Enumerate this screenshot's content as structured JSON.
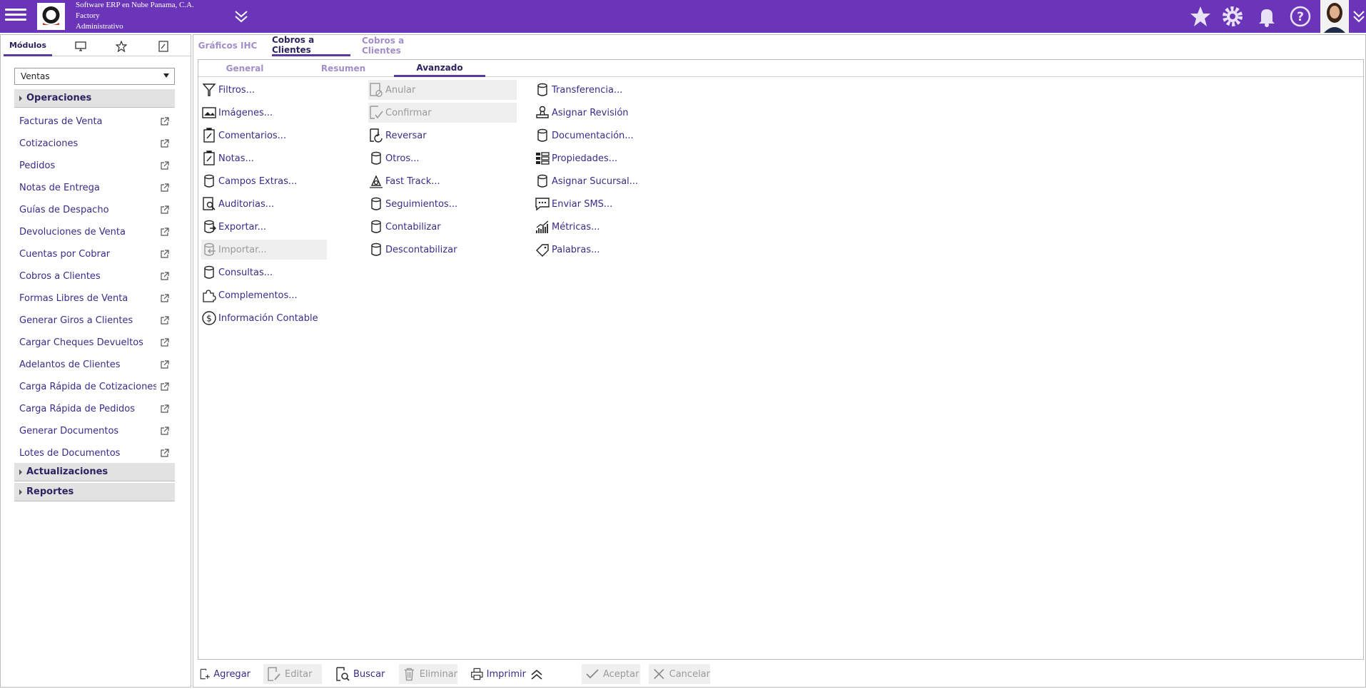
{
  "header": {
    "company_line1": "Software ERP en Nube Panama, C.A.",
    "company_line2": "Factory",
    "company_line3": "Administrativo",
    "icons": [
      "star-icon",
      "gear-icon",
      "bell-icon",
      "help-icon"
    ],
    "accent_color": "#6a35b9"
  },
  "left_panel": {
    "tabs": {
      "modules_label": "Módulos"
    },
    "module_select_value": "Ventas",
    "groups": {
      "operaciones": "Operaciones",
      "actualizaciones": "Actualizaciones",
      "reportes": "Reportes"
    },
    "items": [
      "Facturas de Venta",
      "Cotizaciones",
      "Pedidos",
      "Notas de Entrega",
      "Guías de Despacho",
      "Devoluciones de Venta",
      "Cuentas por Cobrar",
      "Cobros a Clientes",
      "Formas Libres de Venta",
      "Generar Giros a Clientes",
      "Cargar Cheques Devueltos",
      "Adelantos de Clientes",
      "Carga Rápida de Cotizaciones",
      "Carga Rápida de Pedidos",
      "Generar Documentos",
      "Lotes de Documentos"
    ]
  },
  "main": {
    "tabs": [
      "Gráficos IHC",
      "Cobros a Clientes",
      "Cobros a Clientes"
    ],
    "sub_tabs": [
      "General",
      "Resumen",
      "Avanzado"
    ],
    "actions": {
      "col1": [
        "Filtros...",
        "Imágenes...",
        "Comentarios...",
        "Notas...",
        "Campos Extras...",
        "Auditorias...",
        "Exportar...",
        "Importar...",
        "Consultas...",
        "Complementos...",
        "Información Contable"
      ],
      "col2": [
        "Anular",
        "Confirmar",
        "Reversar",
        "Otros...",
        "Fast Track...",
        "Seguimientos...",
        "Contabilizar",
        "Descontabilizar"
      ],
      "col3": [
        "Transferencia...",
        "Asignar Revisión",
        "Documentación...",
        "Propiedades...",
        "Asignar Sucursal...",
        "Enviar SMS...",
        "Métricas...",
        "Palabras..."
      ]
    }
  },
  "toolbar": {
    "add": "Agregar",
    "edit": "Editar",
    "search": "Buscar",
    "delete": "Eliminar",
    "print": "Imprimir",
    "accept": "Aceptar",
    "cancel": "Cancelar"
  }
}
